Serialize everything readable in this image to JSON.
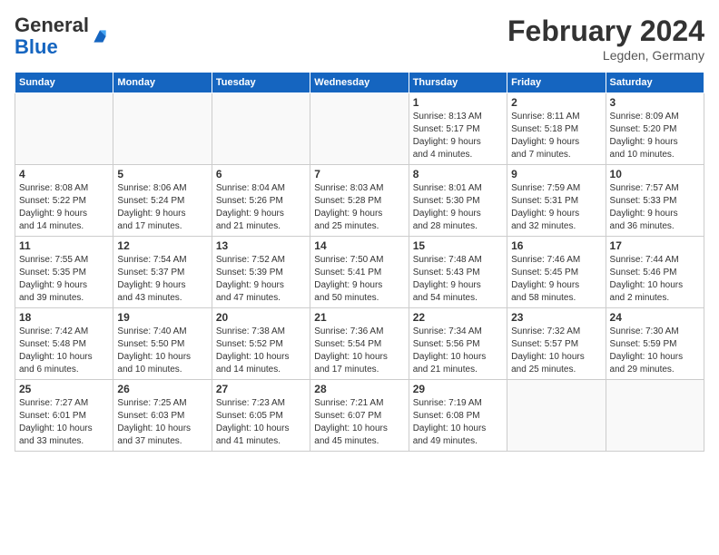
{
  "logo": {
    "general": "General",
    "blue": "Blue"
  },
  "title": "February 2024",
  "location": "Legden, Germany",
  "days_of_week": [
    "Sunday",
    "Monday",
    "Tuesday",
    "Wednesday",
    "Thursday",
    "Friday",
    "Saturday"
  ],
  "weeks": [
    [
      {
        "day": "",
        "info": ""
      },
      {
        "day": "",
        "info": ""
      },
      {
        "day": "",
        "info": ""
      },
      {
        "day": "",
        "info": ""
      },
      {
        "day": "1",
        "info": "Sunrise: 8:13 AM\nSunset: 5:17 PM\nDaylight: 9 hours\nand 4 minutes."
      },
      {
        "day": "2",
        "info": "Sunrise: 8:11 AM\nSunset: 5:18 PM\nDaylight: 9 hours\nand 7 minutes."
      },
      {
        "day": "3",
        "info": "Sunrise: 8:09 AM\nSunset: 5:20 PM\nDaylight: 9 hours\nand 10 minutes."
      }
    ],
    [
      {
        "day": "4",
        "info": "Sunrise: 8:08 AM\nSunset: 5:22 PM\nDaylight: 9 hours\nand 14 minutes."
      },
      {
        "day": "5",
        "info": "Sunrise: 8:06 AM\nSunset: 5:24 PM\nDaylight: 9 hours\nand 17 minutes."
      },
      {
        "day": "6",
        "info": "Sunrise: 8:04 AM\nSunset: 5:26 PM\nDaylight: 9 hours\nand 21 minutes."
      },
      {
        "day": "7",
        "info": "Sunrise: 8:03 AM\nSunset: 5:28 PM\nDaylight: 9 hours\nand 25 minutes."
      },
      {
        "day": "8",
        "info": "Sunrise: 8:01 AM\nSunset: 5:30 PM\nDaylight: 9 hours\nand 28 minutes."
      },
      {
        "day": "9",
        "info": "Sunrise: 7:59 AM\nSunset: 5:31 PM\nDaylight: 9 hours\nand 32 minutes."
      },
      {
        "day": "10",
        "info": "Sunrise: 7:57 AM\nSunset: 5:33 PM\nDaylight: 9 hours\nand 36 minutes."
      }
    ],
    [
      {
        "day": "11",
        "info": "Sunrise: 7:55 AM\nSunset: 5:35 PM\nDaylight: 9 hours\nand 39 minutes."
      },
      {
        "day": "12",
        "info": "Sunrise: 7:54 AM\nSunset: 5:37 PM\nDaylight: 9 hours\nand 43 minutes."
      },
      {
        "day": "13",
        "info": "Sunrise: 7:52 AM\nSunset: 5:39 PM\nDaylight: 9 hours\nand 47 minutes."
      },
      {
        "day": "14",
        "info": "Sunrise: 7:50 AM\nSunset: 5:41 PM\nDaylight: 9 hours\nand 50 minutes."
      },
      {
        "day": "15",
        "info": "Sunrise: 7:48 AM\nSunset: 5:43 PM\nDaylight: 9 hours\nand 54 minutes."
      },
      {
        "day": "16",
        "info": "Sunrise: 7:46 AM\nSunset: 5:45 PM\nDaylight: 9 hours\nand 58 minutes."
      },
      {
        "day": "17",
        "info": "Sunrise: 7:44 AM\nSunset: 5:46 PM\nDaylight: 10 hours\nand 2 minutes."
      }
    ],
    [
      {
        "day": "18",
        "info": "Sunrise: 7:42 AM\nSunset: 5:48 PM\nDaylight: 10 hours\nand 6 minutes."
      },
      {
        "day": "19",
        "info": "Sunrise: 7:40 AM\nSunset: 5:50 PM\nDaylight: 10 hours\nand 10 minutes."
      },
      {
        "day": "20",
        "info": "Sunrise: 7:38 AM\nSunset: 5:52 PM\nDaylight: 10 hours\nand 14 minutes."
      },
      {
        "day": "21",
        "info": "Sunrise: 7:36 AM\nSunset: 5:54 PM\nDaylight: 10 hours\nand 17 minutes."
      },
      {
        "day": "22",
        "info": "Sunrise: 7:34 AM\nSunset: 5:56 PM\nDaylight: 10 hours\nand 21 minutes."
      },
      {
        "day": "23",
        "info": "Sunrise: 7:32 AM\nSunset: 5:57 PM\nDaylight: 10 hours\nand 25 minutes."
      },
      {
        "day": "24",
        "info": "Sunrise: 7:30 AM\nSunset: 5:59 PM\nDaylight: 10 hours\nand 29 minutes."
      }
    ],
    [
      {
        "day": "25",
        "info": "Sunrise: 7:27 AM\nSunset: 6:01 PM\nDaylight: 10 hours\nand 33 minutes."
      },
      {
        "day": "26",
        "info": "Sunrise: 7:25 AM\nSunset: 6:03 PM\nDaylight: 10 hours\nand 37 minutes."
      },
      {
        "day": "27",
        "info": "Sunrise: 7:23 AM\nSunset: 6:05 PM\nDaylight: 10 hours\nand 41 minutes."
      },
      {
        "day": "28",
        "info": "Sunrise: 7:21 AM\nSunset: 6:07 PM\nDaylight: 10 hours\nand 45 minutes."
      },
      {
        "day": "29",
        "info": "Sunrise: 7:19 AM\nSunset: 6:08 PM\nDaylight: 10 hours\nand 49 minutes."
      },
      {
        "day": "",
        "info": ""
      },
      {
        "day": "",
        "info": ""
      }
    ]
  ]
}
